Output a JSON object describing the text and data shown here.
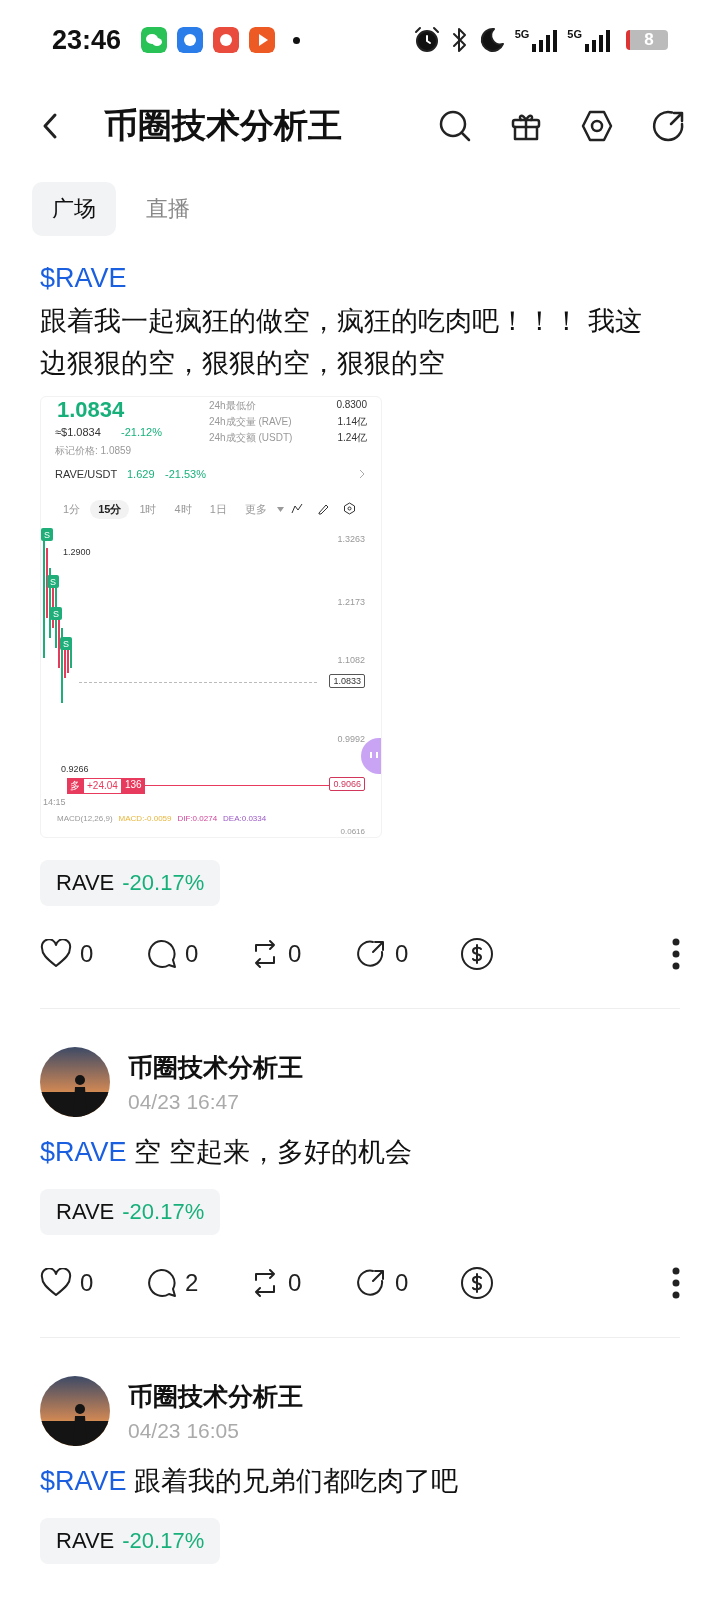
{
  "status_bar": {
    "time": "23:46",
    "apps": [
      {
        "kind": "chat"
      },
      {
        "kind": "blue"
      },
      {
        "kind": "mascot"
      },
      {
        "kind": "play"
      }
    ],
    "signals": [
      "5G",
      "5G"
    ],
    "battery": "8"
  },
  "header": {
    "title": "币圈技术分析王"
  },
  "tabs": [
    {
      "label": "广场",
      "selected": true
    },
    {
      "label": "直播",
      "selected": false
    }
  ],
  "posts": [
    {
      "ticker": "$RAVE",
      "ticker_own_line": true,
      "text": "跟着我一起疯狂的做空，疯狂的吃肉吧！！！ 我这边狠狠的空，狠狠的空，狠狠的空",
      "chart_screenshot": {
        "price": "1.0834",
        "usd_price": "≈$1.0834",
        "change": "-21.12%",
        "mark_price": "标记价格: 1.0859",
        "stats": [
          {
            "label": "24h最低价",
            "value": "0.8300"
          },
          {
            "label": "24h成交量 (RAVE)",
            "value": "1.14亿"
          },
          {
            "label": "24h成交额 (USDT)",
            "value": "1.24亿"
          }
        ],
        "pair": "RAVE/USDT",
        "pair_price": "1.629",
        "pair_change": "-21.53%",
        "intervals": [
          {
            "label": "1分",
            "selected": false
          },
          {
            "label": "15分",
            "selected": true
          },
          {
            "label": "1时",
            "selected": false
          },
          {
            "label": "4时",
            "selected": false
          },
          {
            "label": "1日",
            "selected": false
          }
        ],
        "more": "更多",
        "axis_labels": [
          "1.3263",
          "1.2173",
          "1.1082",
          "0.9992"
        ],
        "high_label": "1.2900",
        "current_price": "1.0833",
        "low_label": "0.9266",
        "position": {
          "side": "多",
          "pnl": "+24.04",
          "size": "136",
          "price": "0.9066"
        },
        "time_label": "14:15",
        "macd": {
          "title": "MACD(12,26,9)",
          "macd": "MACD:-0.0059",
          "dif": "DIF:0.0274",
          "dea": "DEA:0.0334"
        },
        "macd_axis": "0.0616",
        "sell_marks": [
          "S",
          "S",
          "S",
          "S"
        ]
      },
      "tag": {
        "symbol": "RAVE",
        "change": "-20.17%"
      },
      "actions": [
        {
          "kind": "like",
          "count": "0"
        },
        {
          "kind": "comment",
          "count": "0"
        },
        {
          "kind": "repost",
          "count": "0"
        },
        {
          "kind": "share",
          "count": "0"
        },
        {
          "kind": "tip"
        },
        {
          "kind": "more"
        }
      ]
    },
    {
      "author": "币圈技术分析王",
      "time": "04/23 16:47",
      "ticker": "$RAVE",
      "ticker_own_line": false,
      "text": "空 空起来，多好的机会",
      "tag": {
        "symbol": "RAVE",
        "change": "-20.17%"
      },
      "actions": [
        {
          "kind": "like",
          "count": "0"
        },
        {
          "kind": "comment",
          "count": "2"
        },
        {
          "kind": "repost",
          "count": "0"
        },
        {
          "kind": "share",
          "count": "0"
        },
        {
          "kind": "tip"
        },
        {
          "kind": "more"
        }
      ]
    },
    {
      "author": "币圈技术分析王",
      "time": "04/23 16:05",
      "ticker": "$RAVE",
      "ticker_own_line": false,
      "text": "跟着我的兄弟们都吃肉了吧",
      "tag": {
        "symbol": "RAVE",
        "change": "-20.17%"
      }
    }
  ]
}
